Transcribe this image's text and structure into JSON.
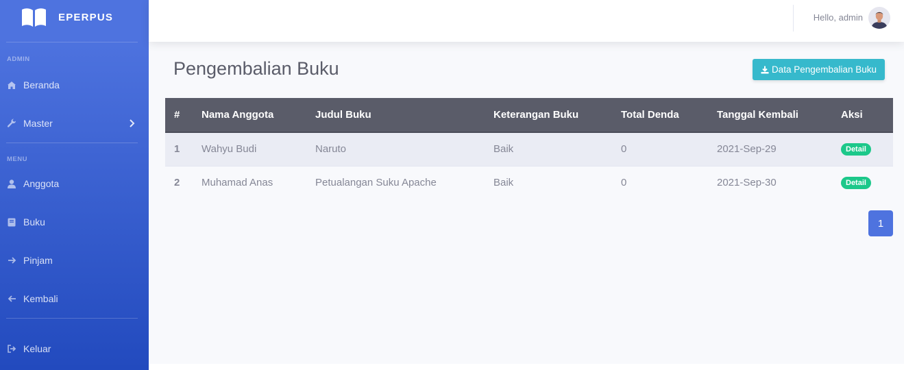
{
  "brand": {
    "name": "EPERPUS"
  },
  "sidebar": {
    "heading_admin": "ADMIN",
    "heading_menu": "MENU",
    "items": [
      {
        "label": "Beranda",
        "icon": "home-icon"
      },
      {
        "label": "Master",
        "icon": "wrench-icon"
      },
      {
        "label": "Anggota",
        "icon": "user-icon"
      },
      {
        "label": "Buku",
        "icon": "book-icon"
      },
      {
        "label": "Pinjam",
        "icon": "arrow-right-icon"
      },
      {
        "label": "Kembali",
        "icon": "arrow-left-icon"
      },
      {
        "label": "Keluar",
        "icon": "sign-out-icon"
      }
    ]
  },
  "topbar": {
    "greeting": "Hello, admin"
  },
  "main": {
    "title": "Pengembalian Buku",
    "export_label": "Data Pengembalian Buku",
    "table": {
      "headers": [
        "#",
        "Nama Anggota",
        "Judul Buku",
        "Keterangan Buku",
        "Total Denda",
        "Tanggal Kembali",
        "Aksi"
      ],
      "rows": [
        {
          "no": "1",
          "nama": "Wahyu Budi",
          "judul": "Naruto",
          "keterangan": "Baik",
          "denda": "0",
          "tanggal": "2021-Sep-29",
          "aksi": "Detail"
        },
        {
          "no": "2",
          "nama": "Muhamad Anas",
          "judul": "Petualangan Suku Apache",
          "keterangan": "Baik",
          "denda": "0",
          "tanggal": "2021-Sep-30",
          "aksi": "Detail"
        }
      ]
    },
    "pagination": {
      "current": "1"
    }
  },
  "colors": {
    "sidebar_top": "#4e73df",
    "sidebar_bottom": "#224abe",
    "export_button": "#36b9cc",
    "table_header": "#5a5c69",
    "badge_success": "#1cc88a",
    "page_active": "#4e73df"
  }
}
